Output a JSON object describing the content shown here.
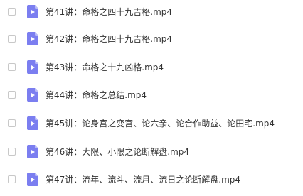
{
  "file_list": {
    "items": [
      {
        "name": "第41讲：命格之四十九吉格.mp4",
        "icon": "video-file-icon"
      },
      {
        "name": "第42讲：命格之四十九吉格.mp4",
        "icon": "video-file-icon"
      },
      {
        "name": "第43讲：命格之十九凶格.mp4",
        "icon": "video-file-icon"
      },
      {
        "name": "第44讲：命格之总结.mp4",
        "icon": "video-file-icon"
      },
      {
        "name": "第45讲：论身宫之变宫、论六亲、论合作助益、论田宅.mp4",
        "icon": "video-file-icon"
      },
      {
        "name": "第46讲：大限、小限之论断解盘.mp4",
        "icon": "video-file-icon"
      },
      {
        "name": "第47讲：流年、流斗、流月、流日之论断解盘.mp4",
        "icon": "video-file-icon"
      }
    ]
  },
  "colors": {
    "icon_fill": "#7b7ef0",
    "icon_fold": "#b9bbf7",
    "text": "#333333",
    "checkbox_border": "#c8c8c8"
  }
}
